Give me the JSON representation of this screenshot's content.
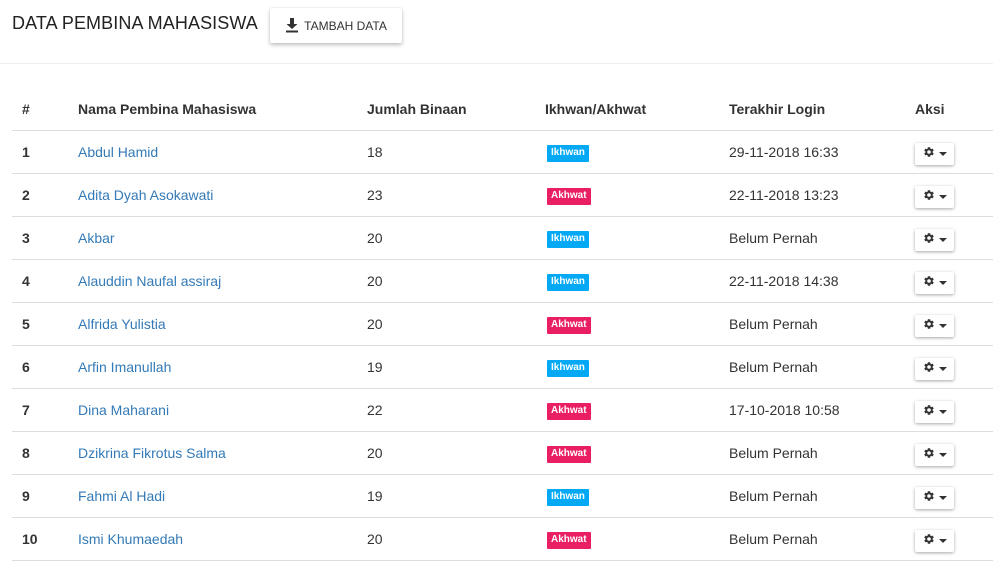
{
  "header": {
    "title": "DATA PEMBINA MAHASISWA",
    "add_button_label": "TAMBAH DATA",
    "add_button_icon": "download-icon"
  },
  "colors": {
    "link": "#337ab7",
    "ikhwan": "#03a9f4",
    "akhwat": "#e91e63"
  },
  "table": {
    "headers": {
      "no": "#",
      "name": "Nama Pembina Mahasiswa",
      "count": "Jumlah Binaan",
      "gender": "Ikhwan/Akhwat",
      "login": "Terakhir Login",
      "action": "Aksi"
    },
    "action_icon": "gear-icon",
    "rows": [
      {
        "no": "1",
        "name": "Abdul Hamid",
        "count": "18",
        "gender": "Ikhwan",
        "login": "29-11-2018 16:33"
      },
      {
        "no": "2",
        "name": "Adita Dyah Asokawati",
        "count": "23",
        "gender": "Akhwat",
        "login": "22-11-2018 13:23"
      },
      {
        "no": "3",
        "name": "Akbar",
        "count": "20",
        "gender": "Ikhwan",
        "login": "Belum Pernah"
      },
      {
        "no": "4",
        "name": "Alauddin Naufal assiraj",
        "count": "20",
        "gender": "Ikhwan",
        "login": "22-11-2018 14:38"
      },
      {
        "no": "5",
        "name": "Alfrida Yulistia",
        "count": "20",
        "gender": "Akhwat",
        "login": "Belum Pernah"
      },
      {
        "no": "6",
        "name": "Arfin Imanullah",
        "count": "19",
        "gender": "Ikhwan",
        "login": "Belum Pernah"
      },
      {
        "no": "7",
        "name": "Dina Maharani",
        "count": "22",
        "gender": "Akhwat",
        "login": "17-10-2018 10:58"
      },
      {
        "no": "8",
        "name": "Dzikrina Fikrotus Salma",
        "count": "20",
        "gender": "Akhwat",
        "login": "Belum Pernah"
      },
      {
        "no": "9",
        "name": "Fahmi Al Hadi",
        "count": "19",
        "gender": "Ikhwan",
        "login": "Belum Pernah"
      },
      {
        "no": "10",
        "name": "Ismi Khumaedah",
        "count": "20",
        "gender": "Akhwat",
        "login": "Belum Pernah"
      }
    ]
  }
}
